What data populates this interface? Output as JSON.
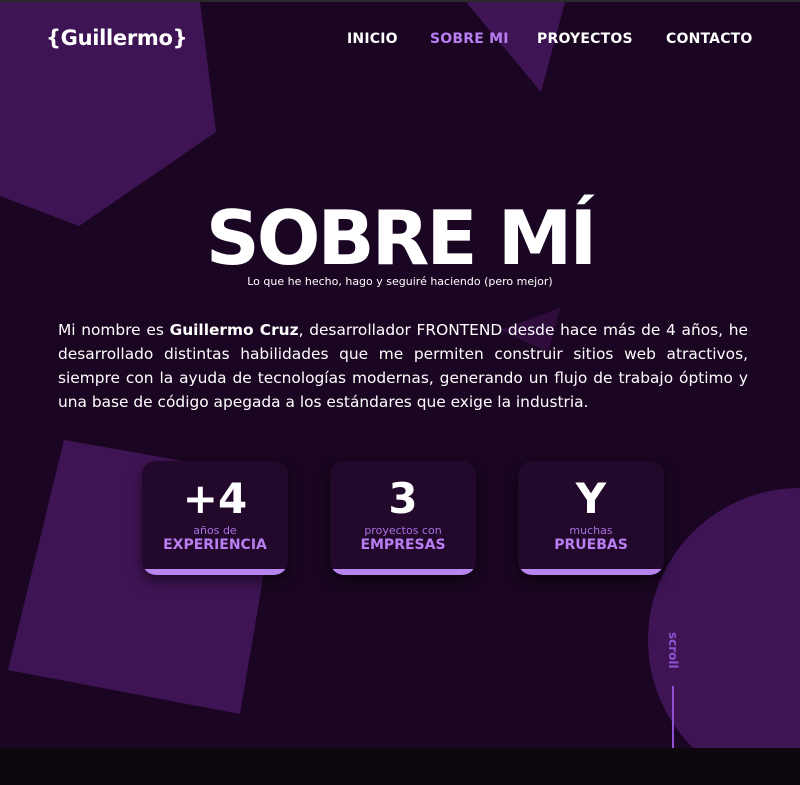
{
  "header": {
    "logo": "{Guillermo}",
    "nav": [
      {
        "label": "INICIO",
        "active": false
      },
      {
        "label": "SOBRE MI",
        "active": true
      },
      {
        "label": "PROYECTOS",
        "active": false
      },
      {
        "label": "CONTACTO",
        "active": false
      }
    ]
  },
  "hero": {
    "title": "SOBRE MÍ",
    "subtitle": "Lo que he hecho, hago y seguiré haciendo (pero mejor)"
  },
  "bio": {
    "intro": "Mi nombre es ",
    "name": "Guillermo Cruz",
    "rest": ", desarrollador FRONTEND desde hace más de 4 años, he desarrollado distintas habilidades que me permiten construir sitios web atractivos, siempre con la ayuda de tecnologías modernas, generando un flujo de trabajo óptimo y una base de código apegada a los estándares que exige la industria."
  },
  "stats": [
    {
      "value": "+4",
      "small": "años de",
      "strong": "EXPERIENCIA"
    },
    {
      "value": "3",
      "small": "proyectos con",
      "strong": "EMPRESAS"
    },
    {
      "value": "Y",
      "small": "muchas",
      "strong": "PRUEBAS"
    }
  ],
  "scroll_label": "scroll",
  "colors": {
    "background": "#1a0622",
    "accent": "#b97ef2",
    "shape": "#3f1455",
    "card": "#22092b"
  },
  "icons": [
    "pentagon-shape",
    "triangle-shape",
    "square-shape",
    "circle-shape"
  ]
}
